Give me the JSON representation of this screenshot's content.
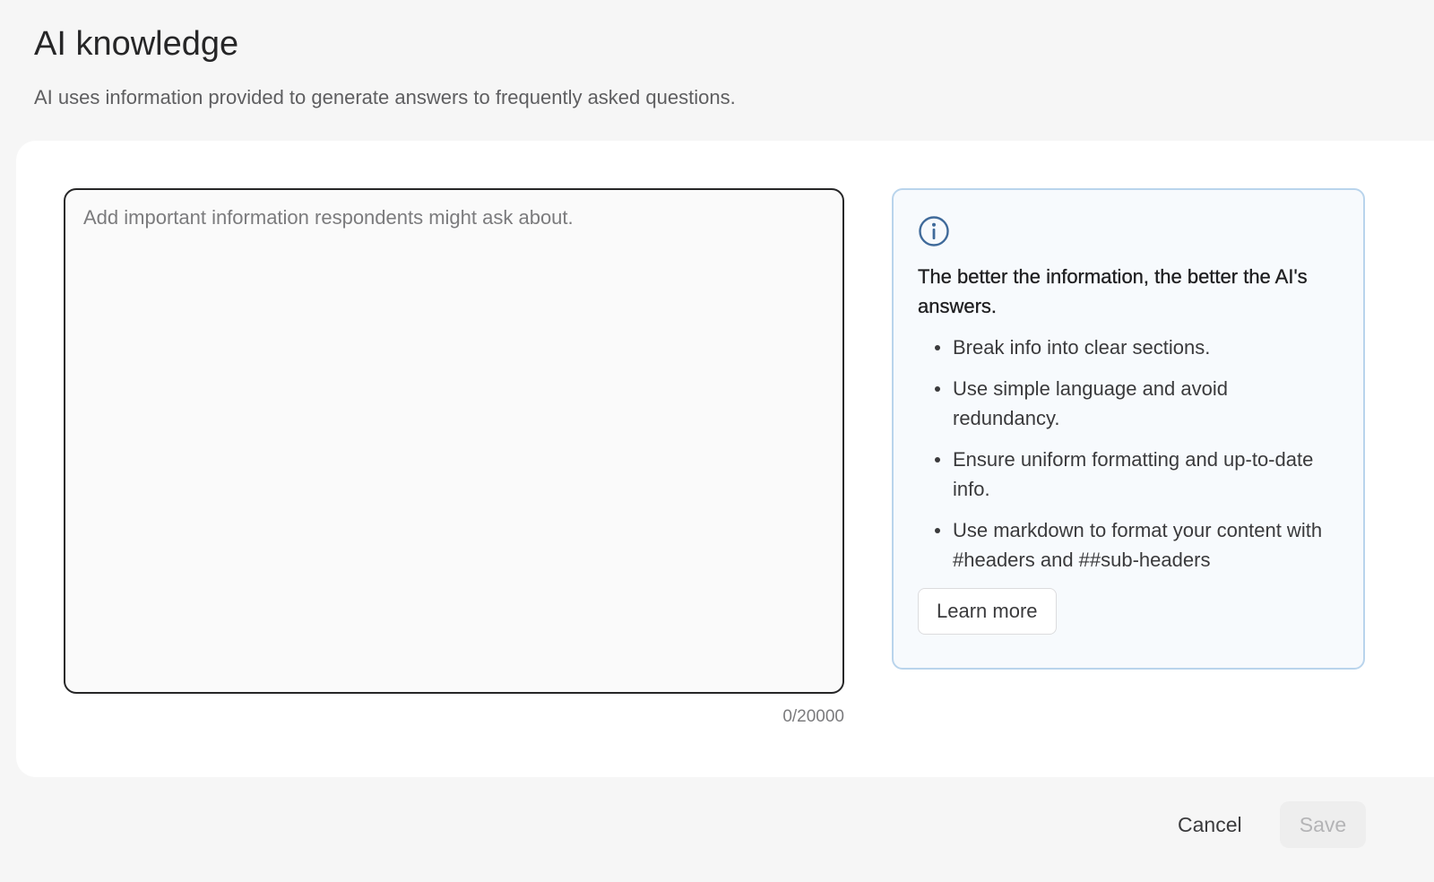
{
  "header": {
    "title": "AI knowledge",
    "subtitle": "AI uses information provided to generate answers to frequently asked questions."
  },
  "editor": {
    "value": "",
    "placeholder": "Add important information respondents might ask about.",
    "counter": "0/20000"
  },
  "info_panel": {
    "icon": "info-icon",
    "heading": "The better the information, the better the AI's answers.",
    "tips": [
      "Break info into clear sections.",
      "Use simple language and avoid redundancy.",
      "Ensure uniform formatting and up-to-date info.",
      "Use markdown to format your content with #headers and ##sub-headers"
    ],
    "learn_more_label": "Learn more"
  },
  "footer": {
    "cancel_label": "Cancel",
    "save_label": "Save"
  },
  "colors": {
    "info_icon": "#3f6a9a",
    "info_border": "#b9d4ec",
    "info_background": "#f7fafd",
    "save_disabled_text": "#b4b4b6"
  }
}
